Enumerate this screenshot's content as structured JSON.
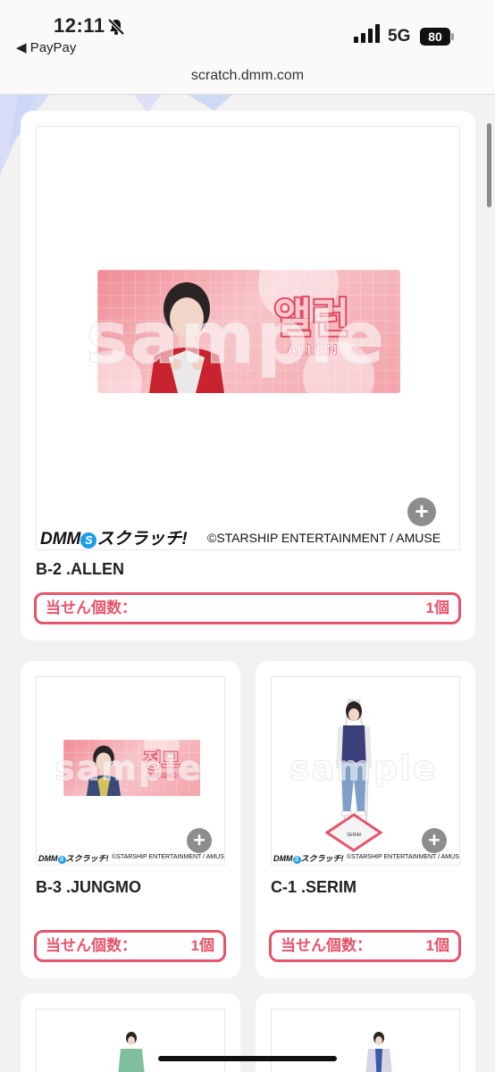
{
  "status_bar": {
    "time": "12:11",
    "back_app": "◀ PayPay",
    "network": "5G",
    "battery": "80"
  },
  "browser": {
    "url": "scratch.dmm.com"
  },
  "footer": {
    "logo_text": "DMM",
    "logo_kana": "スクラッチ!",
    "copyright": "©STARSHIP ENTERTAINMENT / AMUSE"
  },
  "prize_label": "当せん個数：",
  "watermark": "sample",
  "items": [
    {
      "title": "B-2 .ALLEN",
      "count": "1個",
      "korean_name": "앨런",
      "latin_name": "ALLEN"
    },
    {
      "title": "B-3 .JUNGMO",
      "count": "1個",
      "korean_name": "정모",
      "latin_name": "JUNGMO"
    },
    {
      "title": "C-1 .SERIM",
      "count": "1個",
      "stand_label": "SERIM"
    }
  ],
  "colors": {
    "accent": "#e6546a",
    "banner_pink": "#f3a3ab",
    "logo_blue": "#1e9be6"
  }
}
